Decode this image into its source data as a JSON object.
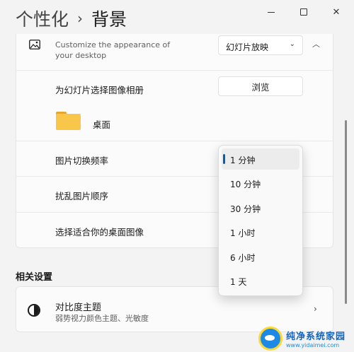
{
  "header": {
    "parent": "个性化",
    "separator": "›",
    "current": "背景"
  },
  "window": {
    "minimize_icon": "minimize-icon",
    "maximize_icon": "maximize-icon",
    "close_glyph": "✕"
  },
  "background_card": {
    "description": "Customize the appearance of your desktop",
    "select_value": "幻灯片放映",
    "select_chevron": "⌄",
    "collapse_chevron": "︿"
  },
  "album": {
    "label": "为幻灯片选择图像相册",
    "browse_label": "浏览",
    "folder_name": "桌面"
  },
  "settings_rows": {
    "interval_label": "图片切换频率",
    "shuffle_label": "扰乱图片顺序",
    "fit_label": "选择适合你的桌面图像"
  },
  "related": {
    "section_title": "相关设置",
    "contrast_title": "对比度主题",
    "contrast_desc": "弱势视力颜色主题、光敏度",
    "chevron": "›"
  },
  "interval_dropdown": {
    "options": [
      {
        "label": "1 分钟",
        "selected": true
      },
      {
        "label": "10 分钟",
        "selected": false
      },
      {
        "label": "30 分钟",
        "selected": false
      },
      {
        "label": "1 小时",
        "selected": false
      },
      {
        "label": "6 小时",
        "selected": false
      },
      {
        "label": "1 天",
        "selected": false
      }
    ]
  },
  "watermark": {
    "title": "纯净系统家园",
    "url": "www.yidaimei.com"
  },
  "colors": {
    "accent": "#005fb8",
    "folder": "#f8c74a",
    "background": "#f3f3f3"
  }
}
